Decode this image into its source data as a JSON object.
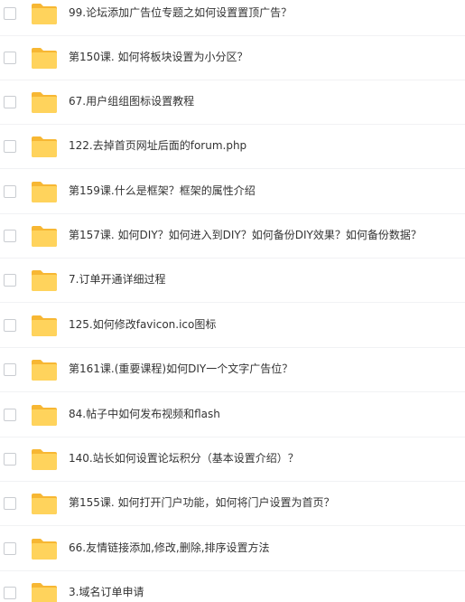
{
  "file_list": {
    "icon": "folder-icon",
    "folder_color": "#ffd35c",
    "items": [
      {
        "name": "99.论坛添加广告位专题之如何设置置顶广告？"
      },
      {
        "name": "第150课. 如何将板块设置为小分区？"
      },
      {
        "name": "67.用户组组图标设置教程"
      },
      {
        "name": "122.去掉首页网址后面的forum.php"
      },
      {
        "name": "第159课.什么是框架？框架的属性介绍"
      },
      {
        "name": "第157课. 如何DIY？如何进入到DIY？如何备份DIY效果？如何备份数据？"
      },
      {
        "name": "7.订单开通详细过程"
      },
      {
        "name": "125.如何修改favicon.ico图标"
      },
      {
        "name": "第161课.(重要课程)如何DIY一个文字广告位？"
      },
      {
        "name": "84.帖子中如何发布视频和flash"
      },
      {
        "name": "140.站长如何设置论坛积分（基本设置介绍）？"
      },
      {
        "name": "第155课. 如何打开门户功能，如何将门户设置为首页？"
      },
      {
        "name": "66.友情链接添加,修改,删除,排序设置方法"
      },
      {
        "name": "3.域名订单申请"
      }
    ]
  }
}
